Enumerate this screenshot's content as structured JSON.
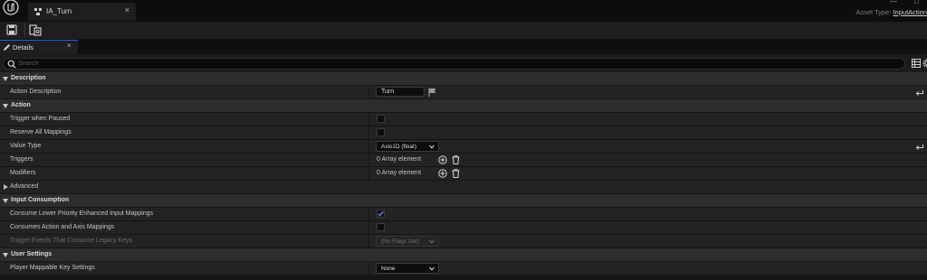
{
  "window": {
    "tab_title": "IA_Turn",
    "tab_close": "×",
    "asset_type_label": "Asset Type:",
    "asset_type_value": "InputAction"
  },
  "details": {
    "tab_label": "Details",
    "tab_close": "×",
    "search_placeholder": "Search"
  },
  "categories": {
    "description": "Description",
    "action": "Action",
    "input_consumption": "Input Consumption",
    "user_settings": "User Settings"
  },
  "properties": {
    "action_description": {
      "label": "Action Description",
      "value": "Turn"
    },
    "trigger_when_paused": {
      "label": "Trigger when Paused",
      "checked": false
    },
    "reserve_all_mappings": {
      "label": "Reserve All Mappings",
      "checked": false
    },
    "value_type": {
      "label": "Value Type",
      "value": "Axis1D (float)"
    },
    "triggers": {
      "label": "Triggers",
      "value": "0 Array element"
    },
    "modifiers": {
      "label": "Modifiers",
      "value": "0 Array element"
    },
    "advanced": {
      "label": "Advanced"
    },
    "consume_lower_priority": {
      "label": "Consume Lower Priority Enhanced Input Mappings",
      "checked": true
    },
    "consumes_action_axis": {
      "label": "Consumes Action and Axis Mappings",
      "checked": false
    },
    "trigger_events_legacy": {
      "label": "Trigger Events That Consume Legacy Keys",
      "value": "(No Flags Set)"
    },
    "player_mappable": {
      "label": "Player Mappable Key Settings",
      "value": "None"
    }
  },
  "colors": {
    "accent": "#2b63c0",
    "checkmark": "#4f8fe6",
    "panel": "#232323",
    "category": "#2d2d2d"
  },
  "icons": [
    "unreal-logo-icon",
    "input-action-icon",
    "save-icon",
    "browse-asset-icon",
    "pencil-icon",
    "search-icon",
    "grid-icon",
    "gear-icon",
    "flag-icon",
    "chevron-down-icon",
    "add-icon",
    "trash-icon",
    "reset-arrow-icon",
    "caret-down-icon",
    "caret-right-icon",
    "checkmark-icon"
  ]
}
